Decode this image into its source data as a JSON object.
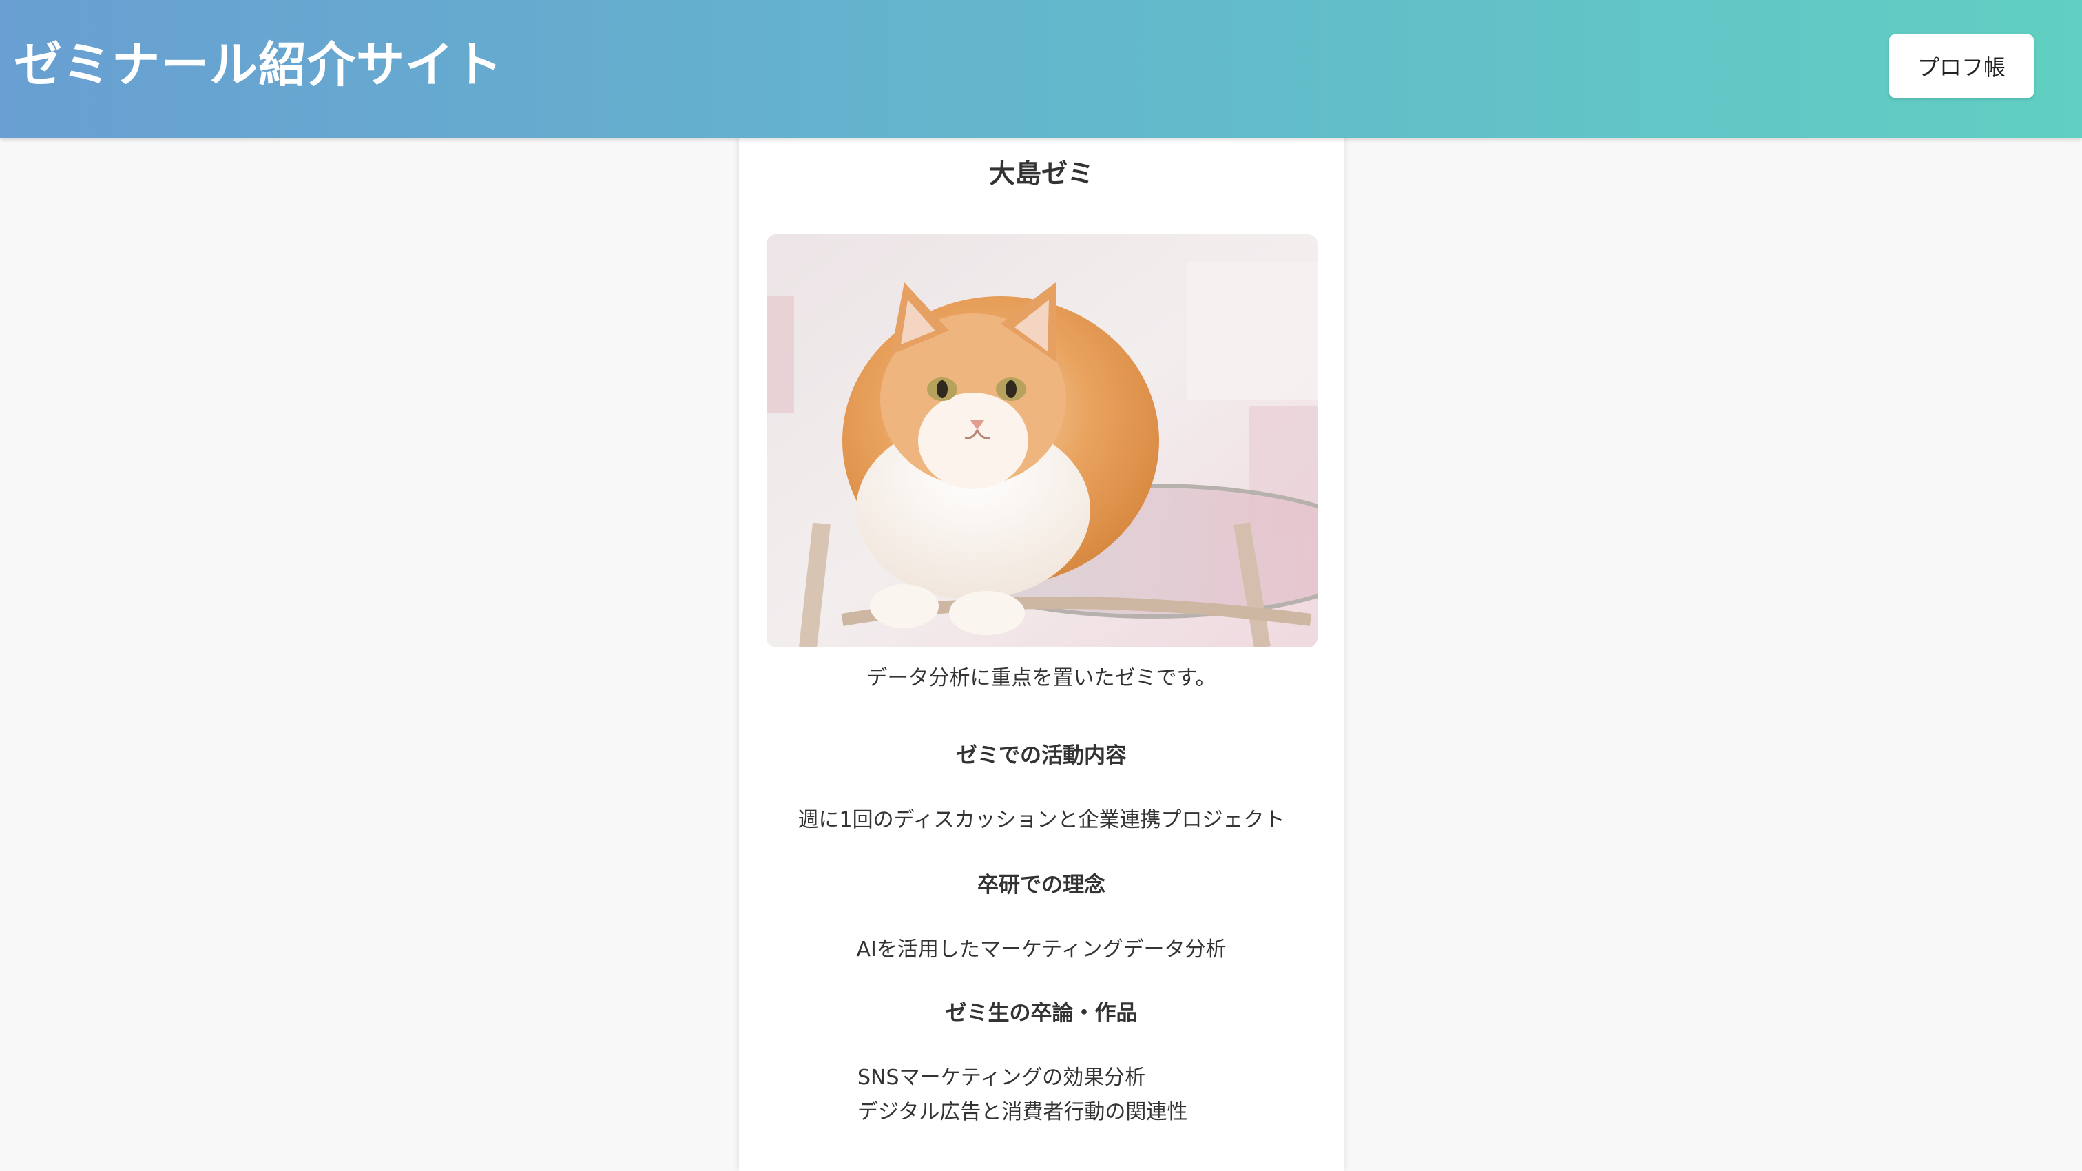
{
  "header": {
    "site_title": "ゼミナール紹介サイト",
    "prof_button_label": "プロフ帳"
  },
  "seminar": {
    "name": "大島ゼミ",
    "description": "データ分析に重点を置いたゼミです。",
    "sections": [
      {
        "heading": "ゼミでの活動内容",
        "body": "週に1回のディスカッションと企業連携プロジェクト"
      },
      {
        "heading": "卒研での理念",
        "body": "AIを活用したマーケティングデータ分析"
      },
      {
        "heading": "ゼミ生の卒論・作品"
      }
    ],
    "works": [
      "SNSマーケティングの効果分析",
      "デジタル広告と消費者行動の関連性"
    ]
  },
  "colors": {
    "header_gradient_start": "#699fd2",
    "header_gradient_end": "#61cfc2",
    "background": "#f8f8f8",
    "card": "#ffffff",
    "text": "#333333"
  }
}
